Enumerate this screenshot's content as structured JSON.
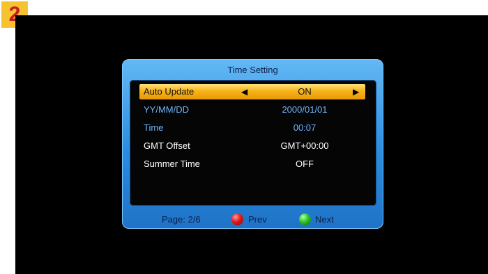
{
  "badge": {
    "number": "2"
  },
  "dialog": {
    "title": "Time Setting",
    "rows": [
      {
        "label": "Auto Update",
        "value": "ON"
      },
      {
        "label": "YY/MM/DD",
        "value": "2000/01/01"
      },
      {
        "label": "Time",
        "value": "00:07"
      },
      {
        "label": "GMT Offset",
        "value": "GMT+00:00"
      },
      {
        "label": "Summer Time",
        "value": "OFF"
      }
    ],
    "arrows": {
      "left": "◀",
      "right": "▶"
    }
  },
  "footer": {
    "page": "Page: 2/6",
    "prev_label": "Prev",
    "next_label": "Next"
  },
  "colors": {
    "badge_bg": "#f7c230",
    "badge_text": "#c41e1e",
    "dialog_frame": "#2a8ce0",
    "selected_row": "#f7b21a",
    "secondary_text": "#6fb6ff"
  }
}
